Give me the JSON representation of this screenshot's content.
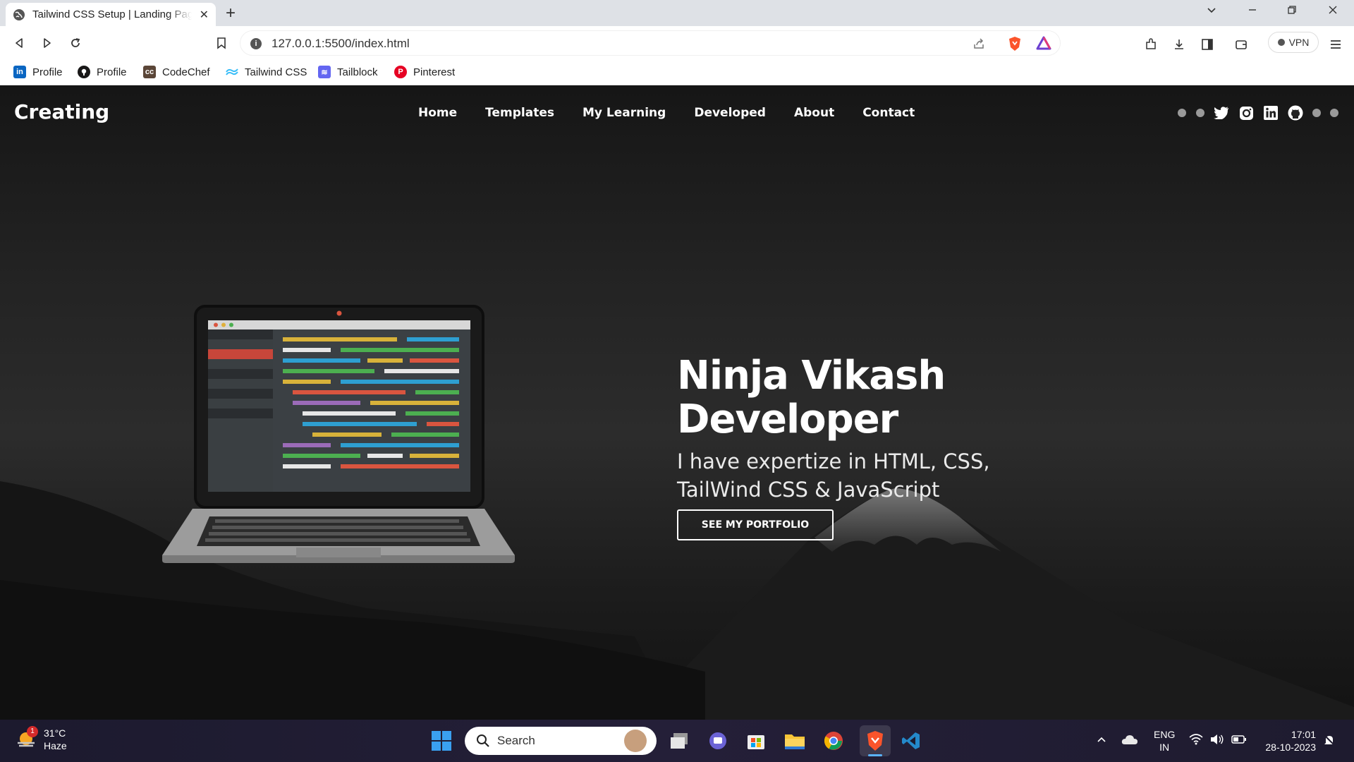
{
  "browser": {
    "tab_title": "Tailwind CSS Setup | Landing Page",
    "url": "127.0.0.1:5500/index.html",
    "vpn_label": "VPN",
    "bookmarks": [
      {
        "label": "Profile",
        "icon": "linkedin-icon",
        "color": "#0a66c2"
      },
      {
        "label": "Profile",
        "icon": "github-icon",
        "color": "#181717"
      },
      {
        "label": "CodeChef",
        "icon": "codechef-icon",
        "color": "#5b4638"
      },
      {
        "label": "Tailwind CSS",
        "icon": "tailwind-icon",
        "color": "#38bdf8"
      },
      {
        "label": "Tailblock",
        "icon": "tailblock-icon",
        "color": "#6366f1"
      },
      {
        "label": "Pinterest",
        "icon": "pinterest-icon",
        "color": "#e60023"
      }
    ]
  },
  "site": {
    "brand": "Creating",
    "nav": [
      "Home",
      "Templates",
      "My Learning",
      "Developed",
      "About",
      "Contact"
    ],
    "social": [
      "twitter-icon",
      "instagram-icon",
      "linkedin-icon",
      "github-icon"
    ],
    "hero": {
      "title_line1": "Ninja Vikash",
      "title_line2": "Developer",
      "subtitle_line1": "I have expertize in HTML, CSS,",
      "subtitle_line2": "TailWind CSS & JavaScript",
      "button": "SEE MY PORTFOLIO"
    }
  },
  "taskbar": {
    "weather_temp": "31°C",
    "weather_desc": "Haze",
    "weather_badge": "1",
    "search_placeholder": "Search",
    "lang_line1": "ENG",
    "lang_line2": "IN",
    "time": "17:01",
    "date": "28-10-2023"
  }
}
